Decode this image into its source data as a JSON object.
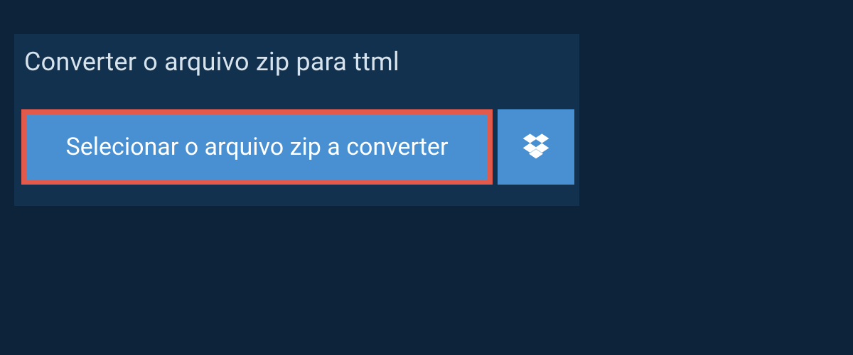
{
  "header": {
    "title": "Converter o arquivo zip para ttml"
  },
  "actions": {
    "select_file_label": "Selecionar o arquivo zip a converter",
    "cloud_provider": "dropbox"
  },
  "colors": {
    "page_bg": "#0d2339",
    "panel_bg": "#11314f",
    "button_bg": "#4990d2",
    "button_text": "#ffffff",
    "highlight_border": "#e25a4b",
    "title_text": "#d7e3ec"
  }
}
